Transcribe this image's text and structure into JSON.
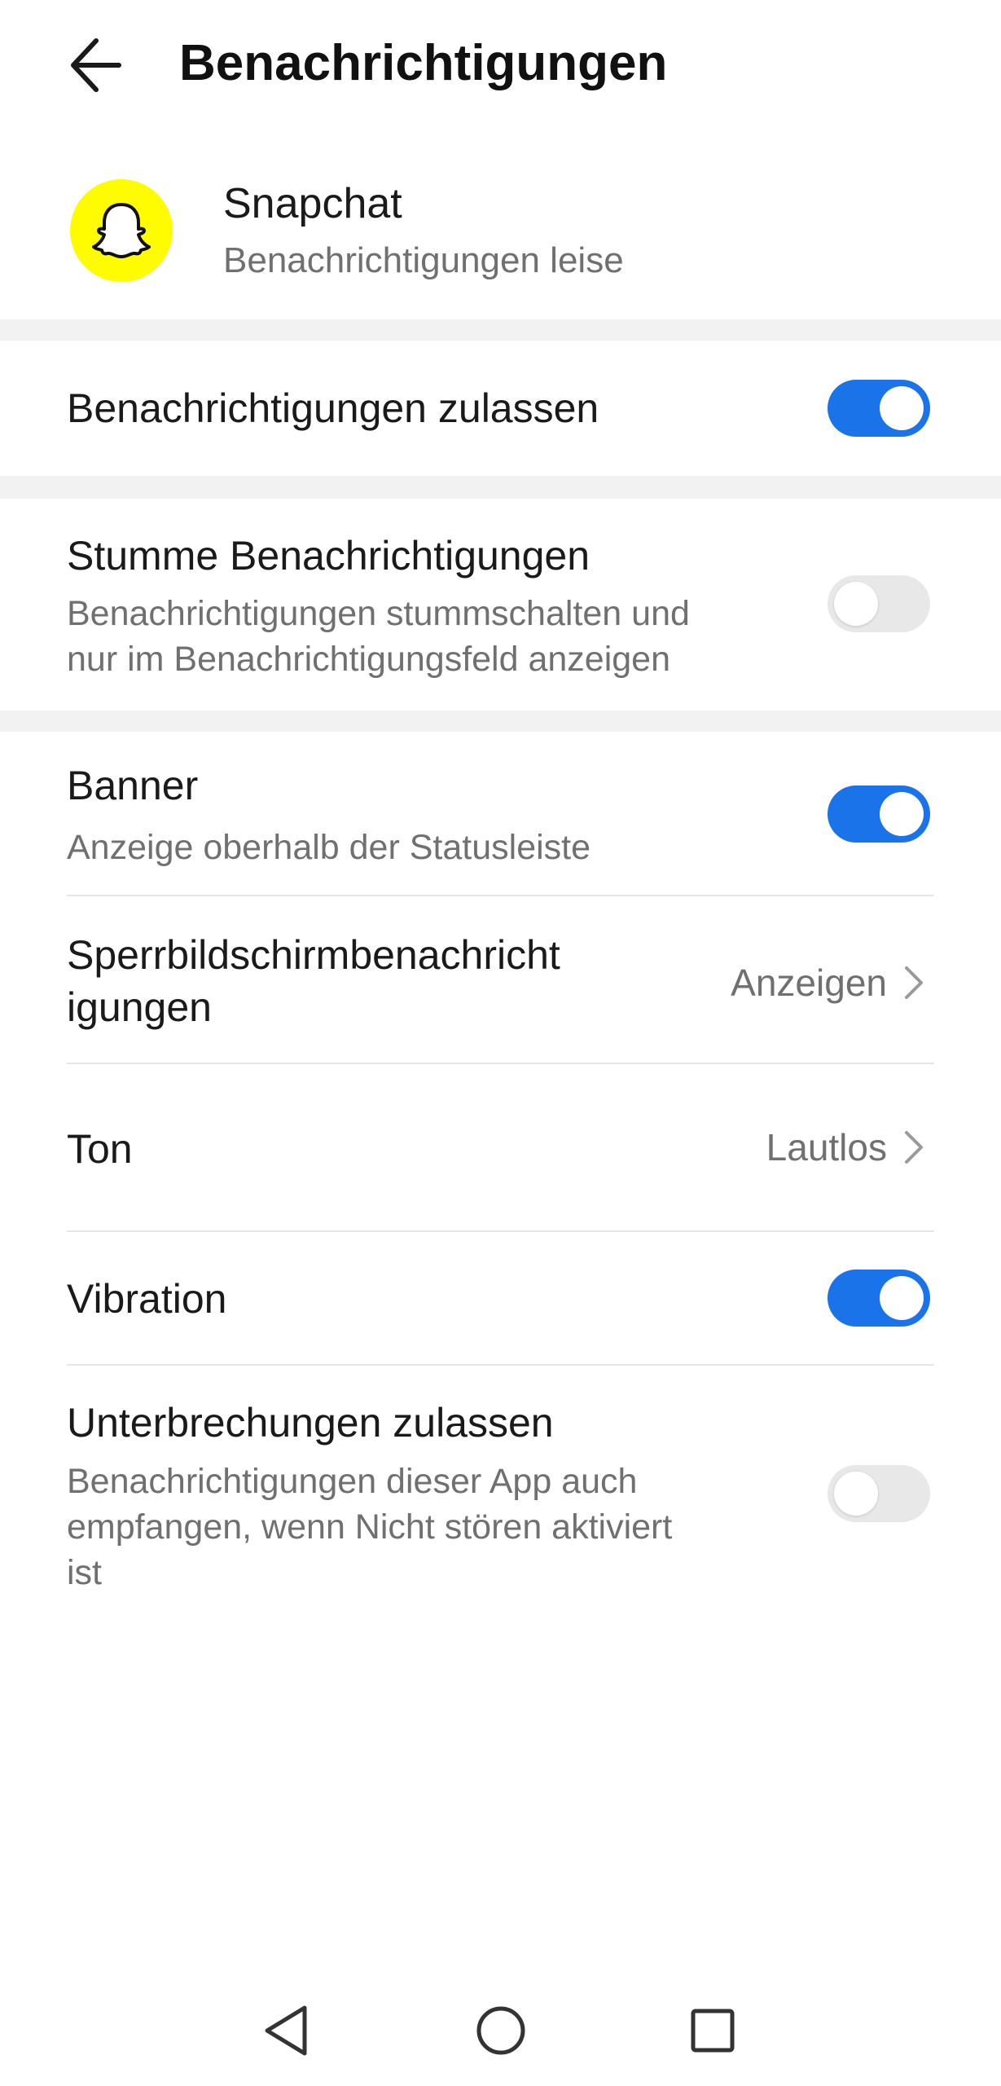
{
  "header": {
    "title": "Benachrichtigungen",
    "back_icon": "arrow-left-icon"
  },
  "app": {
    "name": "Snapchat",
    "status": "Benachrichtigungen leise",
    "icon": "snapchat-ghost-icon",
    "icon_color": "#FFFC00"
  },
  "settings": {
    "allow": {
      "title": "Benachrichtigungen zulassen",
      "enabled": true
    },
    "silent": {
      "title": "Stumme Benachrichtigungen",
      "subtitle": "Benachrichtigungen stummschalten und\nnur im Benachrichtigungsfeld anzeigen",
      "enabled": false
    },
    "banner": {
      "title": "Banner",
      "subtitle": "Anzeige oberhalb der Statusleiste",
      "enabled": true
    },
    "lockscreen": {
      "title": "Sperrbildschirmbenachricht\nigungen",
      "value": "Anzeigen"
    },
    "sound": {
      "title": "Ton",
      "value": "Lautlos"
    },
    "vibration": {
      "title": "Vibration",
      "enabled": true
    },
    "interruptions": {
      "title": "Unterbrechungen zulassen",
      "subtitle": "Benachrichtigungen dieser App auch\nempfangen, wenn Nicht stören aktiviert\nist",
      "enabled": false
    }
  },
  "colors": {
    "accent": "#1a73e8",
    "toggle_off": "#e8e8e8",
    "section_gap": "#f2f2f2"
  },
  "navbar": {
    "back_icon": "triangle-back-icon",
    "home_icon": "circle-home-icon",
    "recents_icon": "square-recents-icon"
  }
}
